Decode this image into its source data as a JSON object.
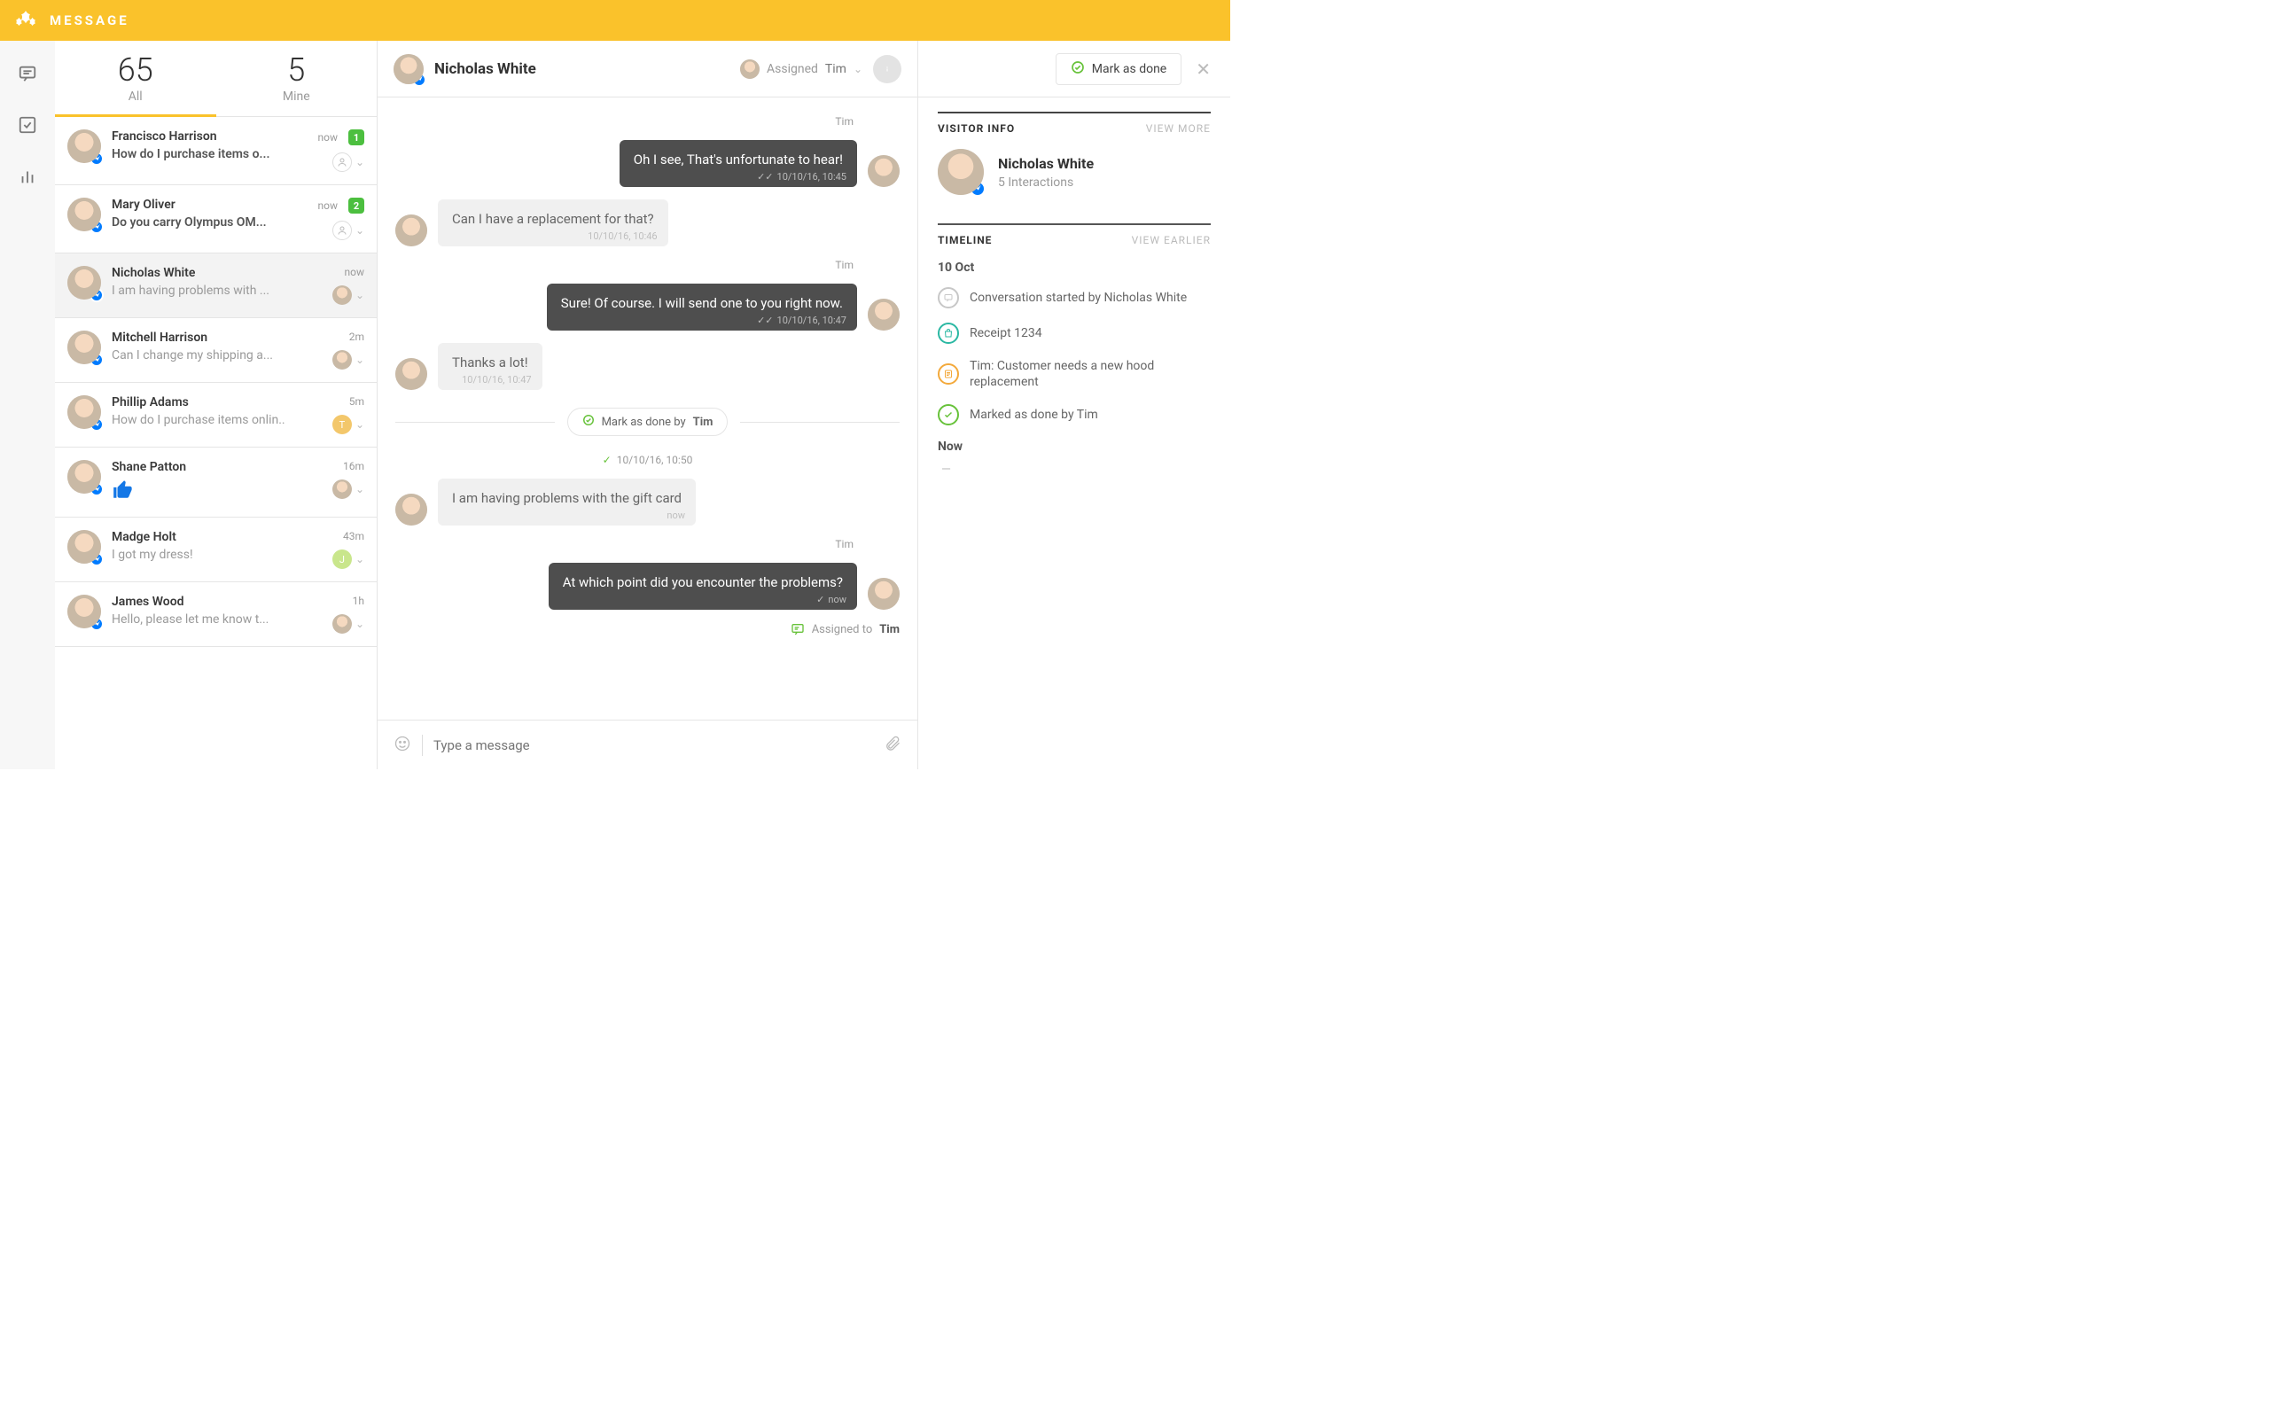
{
  "app": {
    "title": "MESSAGE"
  },
  "convo_header": {
    "name": "Nicholas White",
    "assigned_label": "Assigned",
    "assigned_name": "Tim",
    "mark_done_label": "Mark as done"
  },
  "inbox": {
    "tab_all_count": "65",
    "tab_all_label": "All",
    "tab_mine_count": "5",
    "tab_mine_label": "Mine",
    "threads": [
      {
        "name": "Francisco Harrison",
        "preview": "How do I purchase items o...",
        "time": "now",
        "badge": "1",
        "active": false,
        "assigned_letter": ""
      },
      {
        "name": "Mary Oliver",
        "preview": "Do you carry Olympus OM...",
        "time": "now",
        "badge": "2",
        "active": false,
        "assigned_letter": ""
      },
      {
        "name": "Nicholas White",
        "preview": "I am having problems with ...",
        "time": "now",
        "badge": "",
        "active": true,
        "assigned_letter": ""
      },
      {
        "name": "Mitchell Harrison",
        "preview": "Can I change my shipping a...",
        "time": "2m",
        "badge": "",
        "active": false,
        "assigned_letter": ""
      },
      {
        "name": "Phillip Adams",
        "preview": "How do I purchase items onlin..",
        "time": "5m",
        "badge": "",
        "active": false,
        "assigned_letter": "T"
      },
      {
        "name": "Shane Patton",
        "preview": "thumbs-up",
        "time": "16m",
        "badge": "",
        "active": false,
        "assigned_letter": ""
      },
      {
        "name": "Madge Holt",
        "preview": "I got my dress!",
        "time": "43m",
        "badge": "",
        "active": false,
        "assigned_letter": "J"
      },
      {
        "name": "James Wood",
        "preview": "Hello, please let me know t...",
        "time": "1h",
        "badge": "",
        "active": false,
        "assigned_letter": ""
      }
    ]
  },
  "messages": {
    "items": [
      {
        "side": "sent",
        "sender": "Tim",
        "text": "Oh I see, That's unfortunate to hear!",
        "ts": "10/10/16, 10:45",
        "read": true
      },
      {
        "side": "received",
        "sender": "",
        "text": "Can I have a replacement for that?",
        "ts": "10/10/16, 10:46",
        "read": false
      },
      {
        "side": "sent",
        "sender": "Tim",
        "text": "Sure! Of course. I will send one to you right now.",
        "ts": "10/10/16, 10:47",
        "read": true
      },
      {
        "side": "received",
        "sender": "",
        "text": "Thanks a lot!",
        "ts": "10/10/16, 10:47",
        "read": false
      }
    ],
    "divider_label_prefix": "Mark as done by",
    "divider_name": "Tim",
    "divider_ts": "10/10/16, 10:50",
    "later": [
      {
        "side": "received",
        "sender": "",
        "text": "I am having problems with the gift card",
        "ts": "now",
        "read": false
      },
      {
        "side": "sent",
        "sender": "Tim",
        "text": "At which point did you encounter the problems?",
        "ts": "now",
        "read": false,
        "single_check": true
      }
    ],
    "assigned_note_prefix": "Assigned to",
    "assigned_note_name": "Tim"
  },
  "composer": {
    "placeholder": "Type a message"
  },
  "side": {
    "visitor_heading": "VISITOR INFO",
    "visitor_link": "VIEW MORE",
    "visitor_name": "Nicholas White",
    "visitor_sub": "5 Interactions",
    "timeline_heading": "TIMELINE",
    "timeline_link": "VIEW EARLIER",
    "timeline_date": "10 Oct",
    "timeline_items": [
      {
        "icon": "chat",
        "color": "gray",
        "text": "Conversation started by Nicholas White"
      },
      {
        "icon": "bag",
        "color": "teal",
        "text": "Receipt 1234"
      },
      {
        "icon": "note",
        "color": "orange",
        "text": "Tim: Customer needs a new hood replacement"
      },
      {
        "icon": "check",
        "color": "green",
        "text": "Marked as done by Tim"
      }
    ],
    "timeline_now_label": "Now",
    "timeline_now_value": "—"
  }
}
